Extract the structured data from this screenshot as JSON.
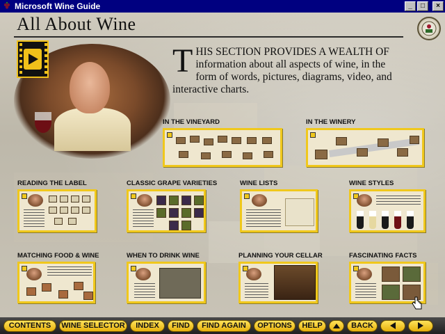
{
  "window": {
    "title": "Microsoft Wine Guide",
    "minimize_glyph": "_",
    "maximize_glyph": "□",
    "close_glyph": "×"
  },
  "page": {
    "title": "All About Wine",
    "intro_dropcap": "T",
    "intro_text": "HIS SECTION PROVIDES A WEALTH OF information about all aspects of wine, in the form of words, pictures, diagrams, video, and interactive charts."
  },
  "sections": [
    {
      "label": "IN THE VINEYARD"
    },
    {
      "label": "IN THE WINERY"
    },
    {
      "label": "READING THE LABEL"
    },
    {
      "label": "CLASSIC GRAPE VARIETIES"
    },
    {
      "label": "WINE LISTS"
    },
    {
      "label": "WINE STYLES"
    },
    {
      "label": "MATCHING FOOD & WINE"
    },
    {
      "label": "WHEN TO DRINK WINE"
    },
    {
      "label": "PLANNING YOUR CELLAR"
    },
    {
      "label": "FASCINATING FACTS"
    }
  ],
  "toolbar": {
    "contents": "CONTENTS",
    "wine_selector": "WINE SELECTOR",
    "index": "INDEX",
    "find": "FIND",
    "find_again": "FIND AGAIN",
    "options": "OPTIONS",
    "help": "HELP",
    "back": "BACK"
  },
  "icons": {
    "app": "wine-grapes-icon",
    "video": "video-film-icon",
    "seal": "wine-guide-seal-icon",
    "up": "up-arrow-icon",
    "prev": "previous-arrow-icon",
    "next": "next-arrow-icon"
  },
  "colors": {
    "titlebar": "#000080",
    "accent_gold": "#f0c81c",
    "toolbar_bg": "#202020"
  }
}
